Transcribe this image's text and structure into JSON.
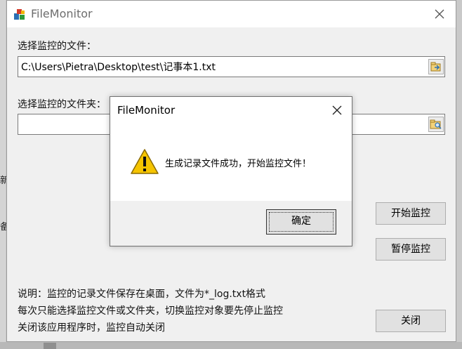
{
  "window": {
    "title": "FileMonitor"
  },
  "file_section": {
    "label": "选择监控的文件：",
    "path_value": "C:\\Users\\Pietra\\Desktop\\test\\记事本1.txt"
  },
  "folder_section": {
    "label": "选择监控的文件夹：",
    "path_value": ""
  },
  "buttons": {
    "start": "开始监控",
    "pause": "暂停监控",
    "close": "关闭"
  },
  "notes": [
    "说明：监控的记录文件保存在桌面，文件为*_log.txt格式",
    "每次只能选择监控文件或文件夹，切换监控对象要先停止监控",
    "关闭该应用程序时，监控自动关闭"
  ],
  "background_fragments": {
    "left_a": "新",
    "left_b": "备"
  },
  "dialog": {
    "title": "FileMonitor",
    "message": "生成记录文件成功，开始监控文件！",
    "ok_label": "确定",
    "icon": "warning-icon"
  },
  "colors": {
    "window_bg": "#f0f0f0",
    "accent_warning": "#f5c400"
  }
}
